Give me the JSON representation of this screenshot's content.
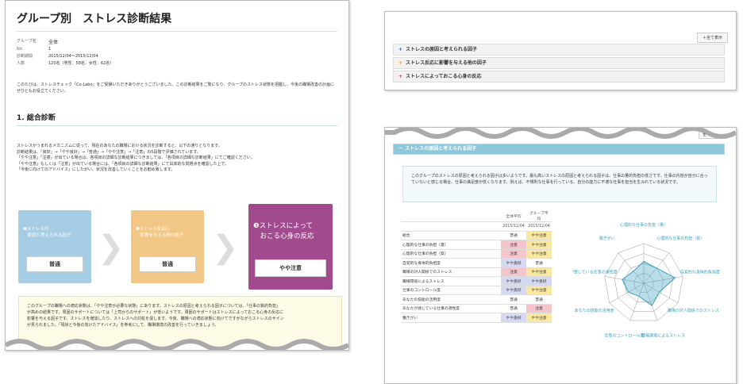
{
  "left": {
    "title": "グループ別　ストレス診断結果",
    "info": [
      {
        "k": "グループ名",
        "v": "全体"
      },
      {
        "k": "No.",
        "v": "1"
      },
      {
        "k": "診断期間",
        "v": "2015/12/04〜2015/12/04"
      },
      {
        "k": "人数",
        "v": "120名（男性：58名、女性：62名）"
      }
    ],
    "intro": "このたびは、ストレスチェック「Co-Labo」をご受験いただきありがとうございました。この診断結果をご覧になり、グループのストレス状態を把握し、今後の職場改善の計画にぜひともお役立てください。",
    "section1": "1. 総合診断",
    "desc": [
      "ストレスがうまれるメカニズムに従って、現在のあなたの職場における状況を診断すると、以下の通りとなります。",
      "診断結果は、「良好」→「やや良好」→「普通」→「やや注意」→「注意」の5段階で評価されています。",
      "「やや注意」「注意」が出ている場合は、各項目の詳細な診断結果につきましては、「各項目の詳細な診断結果」にてご確認ください。",
      "「やや注意」もしくは「注意」が出ている場合には、「各項目の詳細な診断結果」にて具体的な問題点を確認した上で、",
      "「今後に向けてのアドバイス」にしたがい、状況を改善していくことをお勧め致します。"
    ],
    "cards": [
      {
        "cap": "❶ストレスの\n　原因と考えられる因子",
        "result": "普通",
        "color": "#a6cde3"
      },
      {
        "cap": "❷ストレス反応に\n　影響を与える他の因子",
        "result": "普通",
        "color": "#f2c684"
      },
      {
        "cap": "❸ストレスによって\n　おこる心身の反応",
        "result": "やや注意",
        "color": "#a24a8e"
      }
    ],
    "comment": [
      "このグループの職場への適応状態は、「やや注意が必要な状態」にあります。ストレスの原因と考えられる因子については、「仕事の質的負担」",
      "が高めの結果です。周囲のサポートについては「上司からのサポート」が低いようです。周囲のサポートはストレスによっておこる心身の反応に",
      "影響を与える因子です。ストレスを増加したり、ストレスへの対処を促します。今後、職場への適応状態に向けてですがながらストレスのサイン",
      "が見られました。「現状と今後の向けたアドバイス」を参考にして、職場環境の改善を行っていきましょう。"
    ]
  },
  "topright": {
    "expand_all": "＋全て表示",
    "items": [
      {
        "sign": "+",
        "label": "ストレスの原因と考えられる因子",
        "color": "#2a5ca8"
      },
      {
        "sign": "+",
        "label": "ストレス反応に影響を与える他の因子",
        "color": "#e39a22"
      },
      {
        "sign": "+",
        "label": "ストレスによっておこる心身の反応",
        "color": "#a23a8a"
      }
    ]
  },
  "bottomright": {
    "close_all": "全て閉じる",
    "header": "－ ストレスの原因と考えられる因子",
    "intro": "このグループのストレスの原因と考えられる因子は多いようです。最も高いストレスの原因と考えられる因子は、仕事の量的負担の低さです。仕事の内容が自分に合っていないと感じる場合、仕事の満足度が低くなります。例えば、不規則な仕事を行っている、自分の能力に不適な仕事を担当を生みれている状況です。",
    "col_headers": [
      "全体平均",
      "グループ平均"
    ],
    "col_dates": [
      "2015/12/04",
      "2015/12/04"
    ],
    "rows": [
      {
        "label": "総合",
        "a": "普通",
        "b": "やや注意",
        "ac": "",
        "bc": "yel"
      },
      {
        "label": "心理的な仕事の負担（量）",
        "a": "注意",
        "b": "やや注意",
        "ac": "red",
        "bc": "yel"
      },
      {
        "label": "心理的な仕事の負担（質）",
        "a": "注意",
        "b": "やや注意",
        "ac": "red",
        "bc": "yel"
      },
      {
        "label": "自覚的な身体的負担度",
        "a": "やや良好",
        "b": "普通",
        "ac": "blu",
        "bc": ""
      },
      {
        "label": "職場の対人関係でのストレス",
        "a": "注意",
        "b": "やや注意",
        "ac": "red",
        "bc": "yel"
      },
      {
        "label": "職場環境によるストレス",
        "a": "やや良好",
        "b": "やや良好",
        "ac": "blu",
        "bc": "blu"
      },
      {
        "label": "仕事のコントロール度",
        "a": "やや良好",
        "b": "やや注意",
        "ac": "blu",
        "bc": "yel"
      },
      {
        "label": "あなたの技能の活用度",
        "a": "普通",
        "b": "普通",
        "ac": "",
        "bc": ""
      },
      {
        "label": "あなたが感じている仕事の適性度",
        "a": "普通",
        "b": "注意",
        "ac": "",
        "bc": "red"
      },
      {
        "label": "働きがい",
        "a": "やや良好",
        "b": "やや注意",
        "ac": "blu",
        "bc": "yel"
      }
    ],
    "radar_labels": [
      "心理的な仕事の負担（量）",
      "心理的な仕事の負担（質）",
      "自覚的な身体的負担度",
      "職場の対人関係でのストレス",
      "職場環境によるストレス",
      "仕事のコントロール度",
      "あなたの技能の活用度",
      "あなたが感じている仕事の適性度",
      "働きがい"
    ],
    "radar_values": [
      0.55,
      0.5,
      0.8,
      0.45,
      0.6,
      0.35,
      0.45,
      0.55,
      0.4
    ]
  }
}
